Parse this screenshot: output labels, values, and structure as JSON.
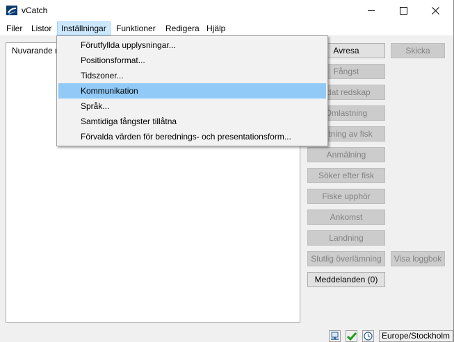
{
  "window": {
    "title": "vCatch"
  },
  "menubar": {
    "items": [
      "Filer",
      "Listor",
      "Inställningar",
      "Funktioner",
      "Redigera",
      "Hjälp"
    ],
    "open_item": "Inställningar"
  },
  "dropdown": {
    "items": [
      "Förutfyllda upplysningar...",
      "Positionsformat...",
      "Tidszoner...",
      "Kommunikation",
      "Språk...",
      "Samtidiga fångster tillåtna",
      "Förvalda värden för berednings- och presentationsform..."
    ],
    "highlighted": "Kommunikation"
  },
  "main": {
    "text": "Nuvarande r"
  },
  "buttons": {
    "avresa": "Avresa",
    "skicka": "Skicka",
    "fangst": "Fångst",
    "redskap": "adat redskap",
    "omlastning": "Omlastning",
    "flyttning": "lyttning av fisk",
    "anmalning": "Anmälning",
    "soker": "Söker efter fisk",
    "fiske_upphor": "Fiske upphör",
    "ankomst": "Ankomst",
    "landning": "Landning",
    "slutlig": "Slutlig överlämning",
    "visa_loggbok": "Visa loggbok",
    "meddelanden": "Meddelanden (0)"
  },
  "statusbar": {
    "icons": [
      "network-icon",
      "checkmark-icon",
      "clock-icon"
    ],
    "timezone": "Europe/Stockholm"
  },
  "colors": {
    "menu_open_bg": "#cce8ff",
    "highlight": "#91c9f7",
    "check_green": "#1f9e1f"
  }
}
